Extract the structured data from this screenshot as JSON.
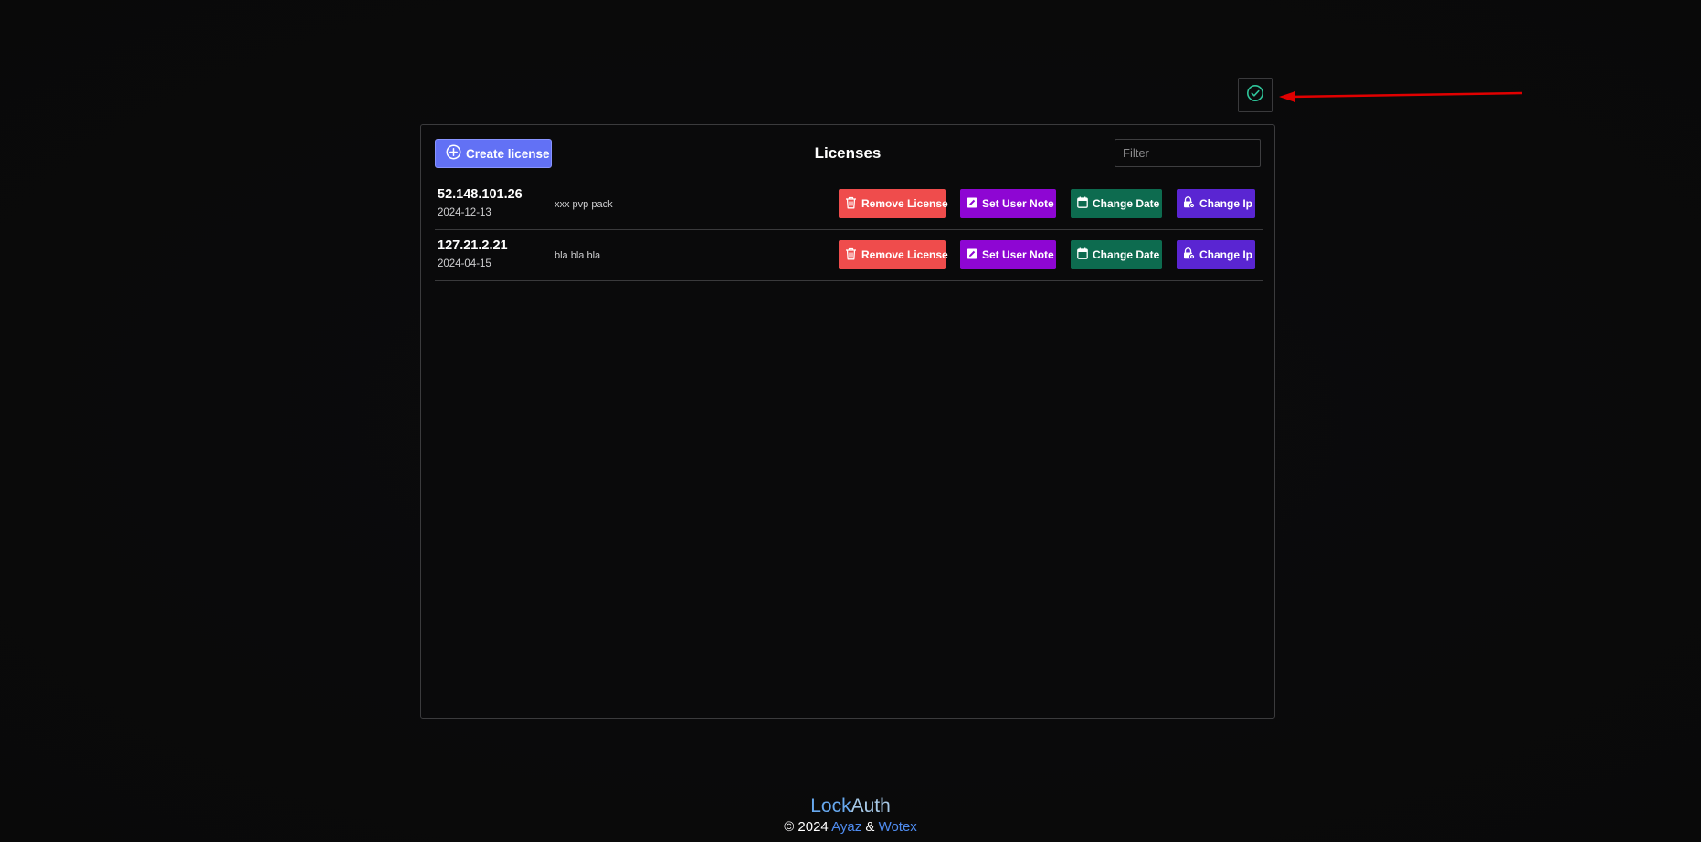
{
  "header": {
    "status_icon": "check-circle-icon",
    "status_color": "#2fc59a"
  },
  "annotation": {
    "arrow_color": "#e00000"
  },
  "panel": {
    "create_button_label": "Create license",
    "title": "Licenses",
    "filter_placeholder": "Filter"
  },
  "licenses": [
    {
      "ip": "52.148.101.26",
      "date": "2024-12-13",
      "note": "xxx pvp pack",
      "actions": {
        "remove": "Remove License",
        "note": "Set User Note",
        "date": "Change Date",
        "ip": "Change Ip"
      }
    },
    {
      "ip": "127.21.2.21",
      "date": "2024-04-15",
      "note": "bla bla bla",
      "actions": {
        "remove": "Remove License",
        "note": "Set User Note",
        "date": "Change Date",
        "ip": "Change Ip"
      }
    }
  ],
  "colors": {
    "create": "#6271f5",
    "remove": "#ef4c4c",
    "note": "#8e06d3",
    "date": "#0d6b4f",
    "ip": "#5a25d2"
  },
  "footer": {
    "brand_part1": "Lock",
    "brand_part2": "Auth",
    "copyright": "© 2024",
    "author1": "Ayaz",
    "separator": "&",
    "author2": "Wotex"
  }
}
